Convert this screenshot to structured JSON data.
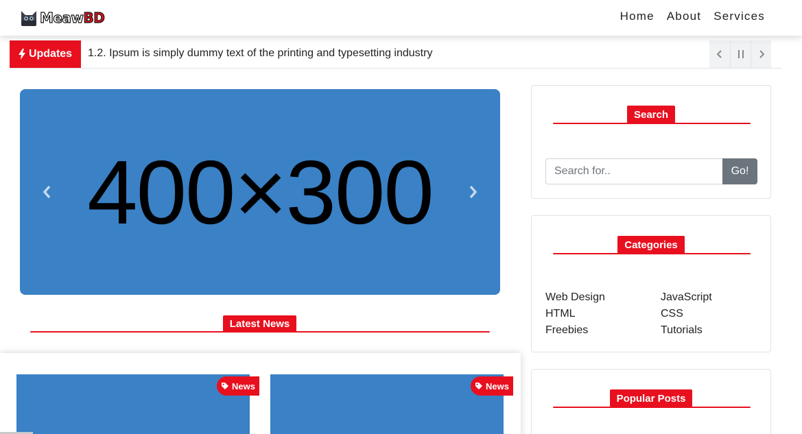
{
  "brand": {
    "name_part1": "Meaw",
    "name_part2": "BD"
  },
  "nav": {
    "links": [
      "Home",
      "About",
      "Services"
    ]
  },
  "ticker": {
    "badge_label": "Updates",
    "text": "1.2. Ipsum is simply dummy text of the printing and typesetting industry",
    "controls": [
      "prev",
      "pause",
      "next"
    ]
  },
  "carousel": {
    "placeholder_text": "400×300"
  },
  "latest_news": {
    "heading": "Latest News",
    "cards": [
      {
        "tag": "News"
      },
      {
        "tag": "News"
      }
    ]
  },
  "sidebar": {
    "search": {
      "heading": "Search",
      "placeholder": "Search for..",
      "button_label": "Go!"
    },
    "categories": {
      "heading": "Categories",
      "items": [
        "Web Design",
        "JavaScript",
        "HTML",
        "CSS",
        "Freebies",
        "Tutorials"
      ]
    },
    "popular_posts": {
      "heading": "Popular Posts"
    }
  },
  "colors": {
    "accent": "#e8101f",
    "placeholder_blue": "#3a81c6",
    "button_gray": "#6c757d"
  }
}
